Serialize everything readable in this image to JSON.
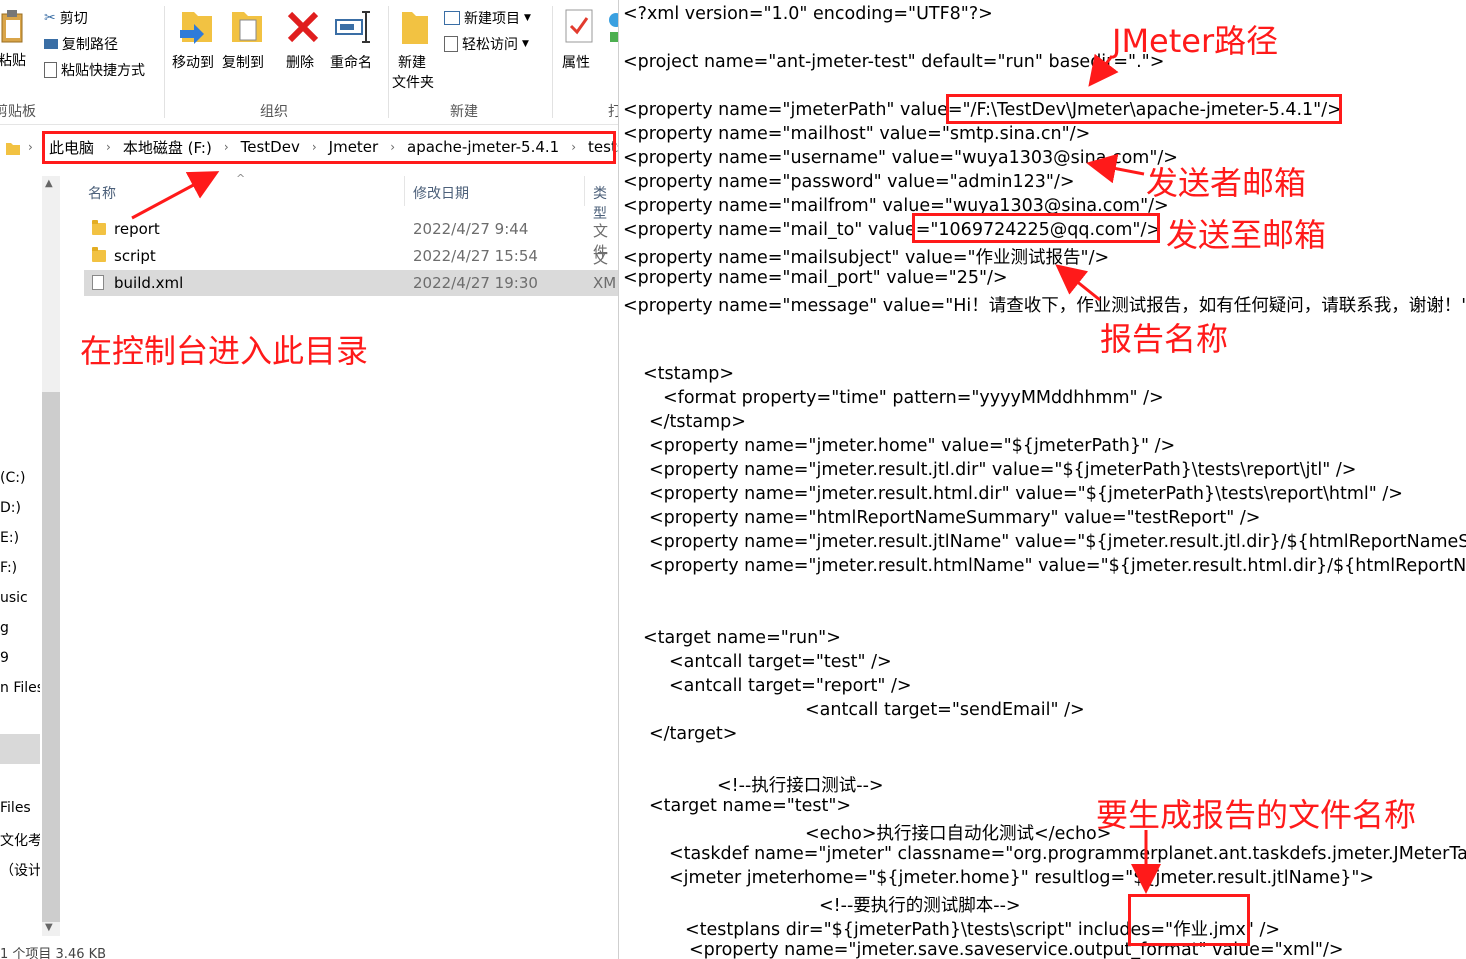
{
  "ribbon": {
    "clipboard": {
      "paste": "粘贴",
      "cut": "剪切",
      "copy_path": "复制路径",
      "paste_shortcut": "粘贴快捷方式",
      "group_label": "剪贴板"
    },
    "organize": {
      "move_to": "移动到",
      "copy_to": "复制到",
      "delete": "删除",
      "rename": "重命名",
      "group_label": "组织"
    },
    "new": {
      "new_folder_line1": "新建",
      "new_folder_line2": "文件夹",
      "new_item": "新建项目",
      "easy_access": "轻松访问",
      "group_label": "新建"
    },
    "open": {
      "properties": "属性",
      "group_label": "打"
    }
  },
  "address": {
    "crumbs": [
      "此电脑",
      "本地磁盘 (F:)",
      "TestDev",
      "Jmeter",
      "apache-jmeter-5.4.1",
      "tests"
    ]
  },
  "nav_pane": {
    "items": [
      "(C:)",
      "D:)",
      "E:)",
      "F:)",
      "usic",
      "g",
      "9",
      "n Files",
      "Files",
      "文化考",
      "（设计"
    ]
  },
  "file_list": {
    "headers": {
      "name": "名称",
      "date": "修改日期",
      "type": "类型"
    },
    "rows": [
      {
        "name": "report",
        "date": "2022/4/27 9:44",
        "type": "文件"
      },
      {
        "name": "script",
        "date": "2022/4/27 15:54",
        "type": "文件"
      },
      {
        "name": "build.xml",
        "date": "2022/4/27 19:30",
        "type": "XM"
      }
    ]
  },
  "status_bar": "1 个项目   3.46 KB",
  "xml_lines": [
    "<?xml version=\"1.0\" encoding=\"UTF8\"?>",
    "<project name=\"ant-jmeter-test\" default=\"run\" basedir=\".\">",
    "<property name=\"jmeterPath\" value=\"/F:\\TestDev\\Jmeter\\apache-jmeter-5.4.1\"/>",
    "<property name=\"mailhost\" value=\"smtp.sina.cn\"/>",
    "<property name=\"username\" value=\"wuya1303@sina.com\"/>",
    "<property name=\"password\" value=\"admin123\"/>",
    "<property name=\"mailfrom\" value=\"wuya1303@sina.com\"/>",
    "<property name=\"mail_to\" value=\"1069724225@qq.com\"/>",
    "<property name=\"mailsubject\" value=\"作业测试报告\"/>",
    "<property name=\"mail_port\" value=\"25\"/>",
    "<property name=\"message\" value=\"Hi！请查收下，作业测试报告，如有任何疑问，请联系我，谢谢！\"/>",
    "<tstamp>",
    "<format property=\"time\" pattern=\"yyyyMMddhhmm\" />",
    "</tstamp>",
    "<property name=\"jmeter.home\" value=\"${jmeterPath}\" />",
    "<property name=\"jmeter.result.jtl.dir\" value=\"${jmeterPath}\\tests\\report\\jtl\" />",
    "<property name=\"jmeter.result.html.dir\" value=\"${jmeterPath}\\tests\\report\\html\" />",
    "<property name=\"htmlReportNameSummary\" value=\"testReport\" />",
    "<property name=\"jmeter.result.jtlName\" value=\"${jmeter.result.jtl.dir}/${htmlReportNameSummary}${time}.jtl\" />",
    "<property name=\"jmeter.result.htmlName\" value=\"${jmeter.result.html.dir}/${htmlReportNameSummary}${time}.html\" />",
    "<target name=\"run\">",
    "<antcall target=\"test\" />",
    "<antcall target=\"report\" />",
    "<antcall target=\"sendEmail\" />",
    "</target>",
    "<!--执行接口测试-->",
    "<target name=\"test\">",
    "<echo>执行接口自动化测试</echo>",
    "<taskdef name=\"jmeter\" classname=\"org.programmerplanet.ant.taskdefs.jmeter.JMeterTask\" />",
    "<jmeter jmeterhome=\"${jmeter.home}\" resultlog=\"${jmeter.result.jtlName}\">",
    "<!--要执行的测试脚本-->",
    "<testplans dir=\"${jmeterPath}\\tests\\script\" includes=\"作业.jmx\" />",
    "<property name=\"jmeter.save.saveservice.output_format\" value=\"xml\"/>"
  ],
  "annotations": {
    "jmeter_path": "JMeter路径",
    "sender_mail": "发送者邮箱",
    "send_to_mail": "发送至邮箱",
    "report_name": "报告名称",
    "console_dir": "在控制台进入此目录",
    "report_file_name": "要生成报告的文件名称"
  },
  "colors": {
    "annotation": "#ff1a1a",
    "selected_row": "#dadada",
    "folder": "#f2c242"
  }
}
